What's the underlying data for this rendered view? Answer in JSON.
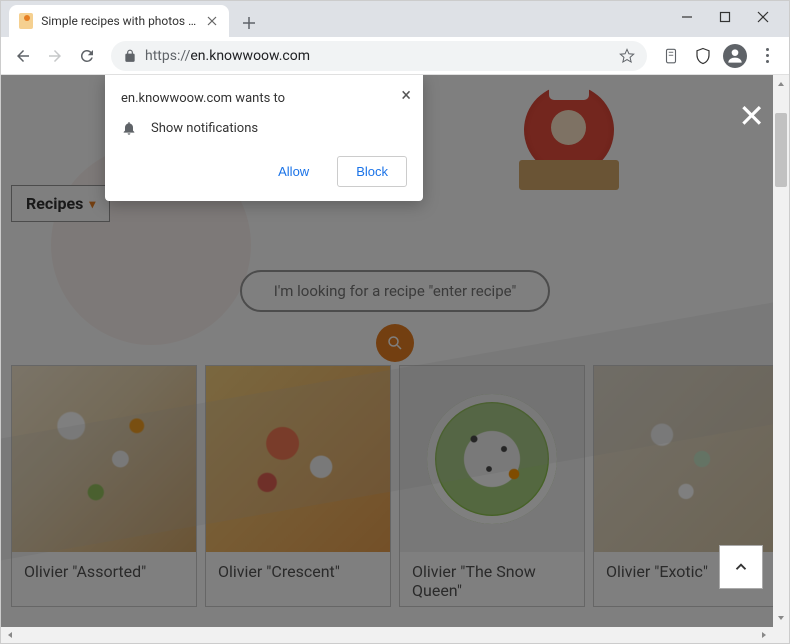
{
  "window": {
    "tab_title": "Simple recipes with photos of ho",
    "url_protocol": "https://",
    "url_host": "en.knowwoow.com"
  },
  "notification": {
    "origin": "en.knowwoow.com wants to",
    "permission": "Show notifications",
    "allow": "Allow",
    "block": "Block"
  },
  "page": {
    "nav_label": "Recipes",
    "search_placeholder": "I'm looking for a recipe \"enter recipe\"",
    "close_overlay": "✕"
  },
  "cards": [
    {
      "title": "Olivier \"Assorted\""
    },
    {
      "title": "Olivier \"Crescent\""
    },
    {
      "title": "Olivier \"The Snow Queen\""
    },
    {
      "title": "Olivier \"Exotic\""
    }
  ]
}
